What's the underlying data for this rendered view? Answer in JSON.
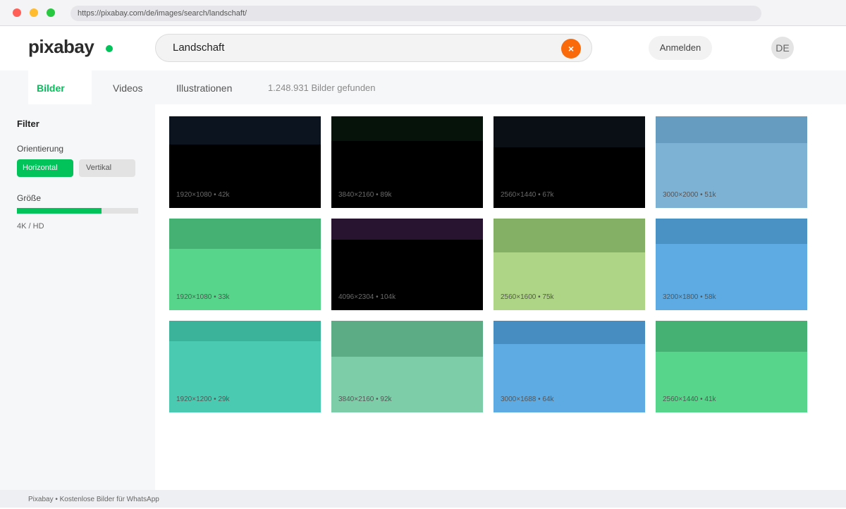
{
  "browser": {
    "url": "https://pixabay.com/de/images/search/landschaft/"
  },
  "header": {
    "logo": "pixabay",
    "search_value": "Landschaft",
    "clear_icon": "×",
    "login_label": "Anmelden",
    "language": "DE"
  },
  "tabs": {
    "bilder": "Bilder",
    "videos": "Videos",
    "illustrationen": "Illustrationen",
    "result_count": "1.248.931 Bilder gefunden"
  },
  "sidebar": {
    "title": "Filter",
    "orientation_label": "Orientierung",
    "horizontal_label": "Horizontal",
    "vertical_label": "Vertikal",
    "size_label": "Größe",
    "size_level": 0.7,
    "size_value": "4K / HD"
  },
  "images": [
    {
      "meta": "1920×1080 • 42k",
      "sky": "#0c1420",
      "ground": "#000000",
      "horizon": 0.31,
      "dark": true
    },
    {
      "meta": "3840×2160 • 89k",
      "sky": "#06130a",
      "ground": "#000000",
      "horizon": 0.27,
      "dark": true
    },
    {
      "meta": "2560×1440 • 67k",
      "sky": "#0a0e15",
      "ground": "#000000",
      "horizon": 0.34,
      "dark": true
    },
    {
      "meta": "3000×2000 • 51k",
      "sky": "#659cc0",
      "ground": "#7db2d5",
      "horizon": 0.29,
      "dark": false
    },
    {
      "meta": "1920×1080 • 33k",
      "sky": "#45b273",
      "ground": "#57d68b",
      "horizon": 0.33,
      "dark": false
    },
    {
      "meta": "4096×2304 • 104k",
      "sky": "#281430",
      "ground": "#000000",
      "horizon": 0.23,
      "dark": true
    },
    {
      "meta": "2560×1600 • 75k",
      "sky": "#83b065",
      "ground": "#aed585",
      "horizon": 0.37,
      "dark": false
    },
    {
      "meta": "3200×1800 • 58k",
      "sky": "#4a92c4",
      "ground": "#5dabe2",
      "horizon": 0.28,
      "dark": false
    },
    {
      "meta": "1920×1200 • 29k",
      "sky": "#3bb29a",
      "ground": "#4acbb1",
      "horizon": 0.22,
      "dark": false
    },
    {
      "meta": "3840×2160 • 92k",
      "sky": "#5cac86",
      "ground": "#7dcea8",
      "horizon": 0.39,
      "dark": false
    },
    {
      "meta": "3000×1688 • 64k",
      "sky": "#478dc1",
      "ground": "#5eabe3",
      "horizon": 0.25,
      "dark": false
    },
    {
      "meta": "2560×1440 • 41k",
      "sky": "#45b172",
      "ground": "#57d68b",
      "horizon": 0.34,
      "dark": false
    }
  ],
  "footer": {
    "text": "Pixabay • Kostenlose Bilder für WhatsApp"
  },
  "colors": {
    "accent": "#02c25a",
    "clear_button": "#fa6a0a"
  }
}
